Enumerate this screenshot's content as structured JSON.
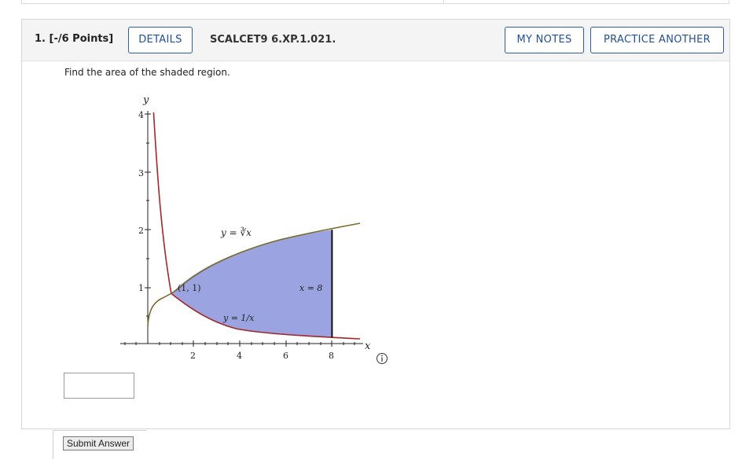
{
  "question": {
    "number_label": "1. [-/6 Points]",
    "details_label": "DETAILS",
    "assignment_code": "SCALCET9 6.XP.1.021.",
    "my_notes_label": "MY NOTES",
    "practice_label": "PRACTICE ANOTHER",
    "prompt": "Find the area of the shaded region."
  },
  "figure": {
    "y_axis_label": "y",
    "x_axis_label": "x",
    "y_ticks": [
      "1",
      "2",
      "3",
      "4"
    ],
    "x_ticks": [
      "2",
      "4",
      "6",
      "8"
    ],
    "curve_upper_label": "y = ∛x",
    "curve_lower_label": "y = 1/x",
    "vertical_line_label": "x = 8",
    "intersection_label": "(1, 1)",
    "shade_color": "#9ba3e0",
    "upper_curve_color": "#7a6a2a",
    "lower_curve_color": "#a3262a",
    "boundary_color": "#111111",
    "info_icon": "info-circle-icon"
  },
  "answer": {
    "value": "",
    "submit_label": "Submit Answer"
  }
}
